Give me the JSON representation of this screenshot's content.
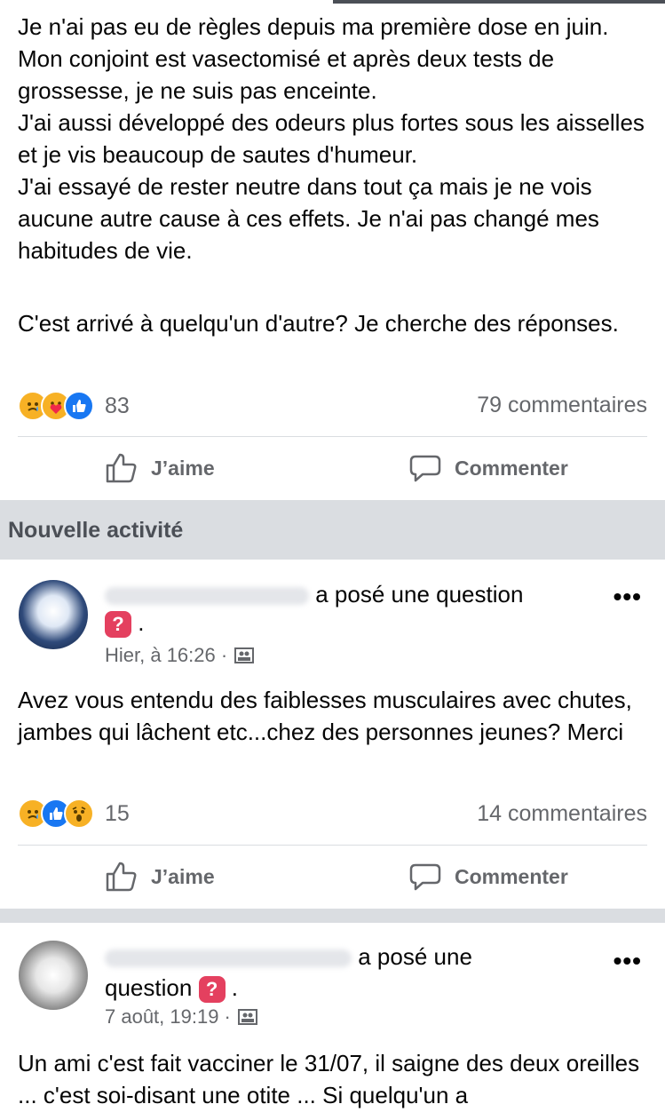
{
  "post1": {
    "paragraphs": [
      "Je n'ai pas eu de règles depuis ma première dose en juin.\nMon conjoint est vasectomisé et après deux tests de grossesse, je ne suis pas enceinte.\nJ'ai aussi développé des odeurs plus fortes sous les aisselles et je vis beaucoup de sautes d'humeur.\nJ'ai essayé de rester neutre dans tout ça mais je ne vois aucune autre cause à ces effets. Je n'ai pas changé mes habitudes de vie.",
      "C'est arrivé à quelqu'un d'autre? Je cherche des réponses."
    ],
    "reaction_count": "83",
    "comments": "79 commentaires",
    "reactions": [
      "sad",
      "care",
      "like"
    ]
  },
  "actions": {
    "like_label": "J’aime",
    "comment_label": "Commenter"
  },
  "section_title": "Nouvelle activité",
  "post2": {
    "action_text": "a posé une question",
    "dot": ".",
    "time": "Hier, à 16:26 ·",
    "body": "Avez vous entendu des faiblesses musculaires avec chutes, jambes qui lâchent etc...chez des personnes jeunes? Merci",
    "reaction_count": "15",
    "comments": "14 commentaires",
    "reactions": [
      "sad",
      "like",
      "wow"
    ]
  },
  "post3": {
    "action_text_1": "a posé une",
    "action_text_2": "question",
    "dot": ".",
    "time": "7 août, 19:19 ·",
    "body": "Un ami c'est fait vacciner le 31/07, il saigne des deux oreilles ... c'est soi-disant une otite ... Si quelqu'un a"
  },
  "colors": {
    "like": "#1877f2",
    "sad": "#f7b125",
    "question_badge": "#e4405f",
    "secondary_text": "#65676b"
  }
}
